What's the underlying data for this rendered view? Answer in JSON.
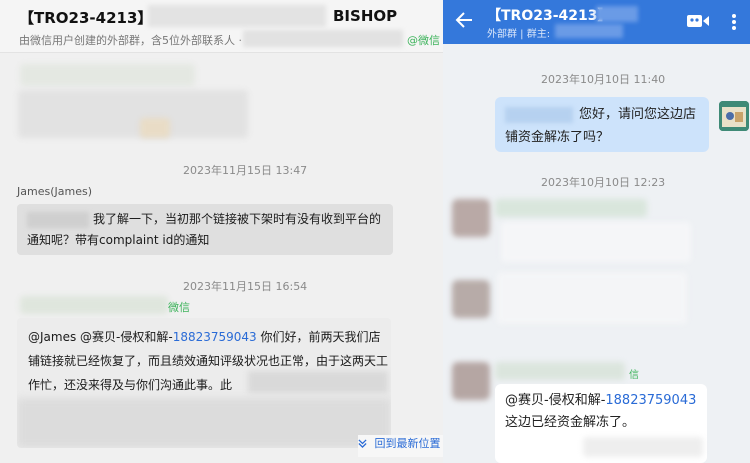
{
  "left_panel": {
    "title": "【TRO23-4213】",
    "title_suffix": "BISHOP",
    "subtitle": "由微信用户创建的外部群，含5位外部联系人 ·",
    "subtitle_tag": "@微信",
    "messages": [
      {
        "time": "2023年11月15日 13:47"
      },
      {
        "sender": "James(James)",
        "text": "我了解一下，当初那个链接被下架时有没有收到平台的通知呢？带有complaint id的通知"
      },
      {
        "time": "2023年11月15日 16:54"
      },
      {
        "sender_tag": "微信",
        "mention_prefix": "@James @赛贝-侵权和解-",
        "mention_phone": "18823759043",
        "text_rest": " 你们好，前两天我们店铺链接就已经恢复了，而且绩效通知评级状况也正常，由于这两天工作忙，还没来得及与你们沟通此事。此"
      }
    ],
    "back_to_latest": "回到最新位置",
    "back_to_latest_icon": "double-chevron-down-icon"
  },
  "right_panel": {
    "title": "【TRO23-4213】",
    "subtitle": "外部群 | 群主:",
    "header_color": "#3478db",
    "messages": [
      {
        "time": "2023年10月10日 11:40"
      },
      {
        "text": "您好，请问您这边店铺资金解冻了吗？"
      },
      {
        "time": "2023年10月10日 12:23"
      },
      {
        "sender_tag": "信"
      },
      {
        "mention_prefix": "@赛贝-侵权和解-",
        "mention_phone": "18823759043",
        "text_rest": " 这边已经资金解冻了。"
      }
    ],
    "icons": [
      "back-arrow-icon",
      "video-call-icon",
      "more-vertical-icon"
    ]
  }
}
